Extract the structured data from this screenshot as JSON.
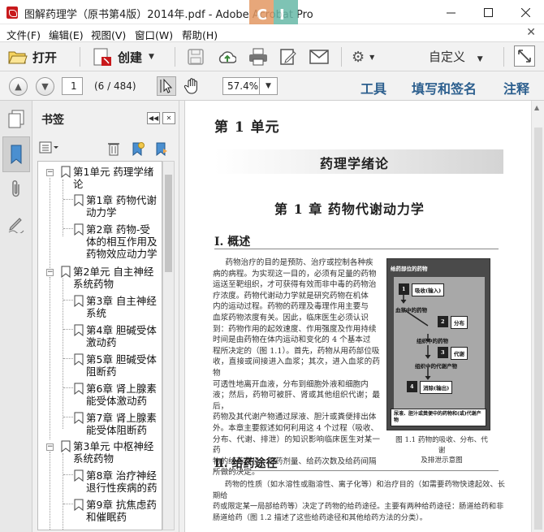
{
  "window": {
    "title": "图解药理学（原书第4版）2014年.pdf - Adobe Acrobat Pro",
    "controls": [
      "minimize",
      "maximize",
      "close"
    ]
  },
  "menu": {
    "items": [
      "文件(F)",
      "编辑(E)",
      "视图(V)",
      "窗口(W)",
      "帮助(H)"
    ]
  },
  "toolbar": {
    "open_label": "打开",
    "create_label": "创建",
    "custom_label": "自定义"
  },
  "nav": {
    "current_page": "1",
    "page_count": "(6 / 484)",
    "zoom": "57.4%",
    "tools_label": "工具",
    "fill_sign_label": "填写和签名",
    "comment_label": "注释"
  },
  "bookmarks": {
    "panel_title": "书签",
    "items": [
      {
        "line1": "第1单元  药理学绪",
        "line2": "论"
      },
      {
        "line1": "第1章  药物代谢",
        "line2": "动力学"
      },
      {
        "line1": "第2章  药物-受",
        "line2": "体的相互作用及",
        "line3": "药物效应动力学"
      },
      {
        "line1": "第2单元  自主神经",
        "line2": "系统药物"
      },
      {
        "line1": "第3章  自主神经",
        "line2": "系统"
      },
      {
        "line1": "第4章  胆碱受体",
        "line2": "激动药"
      },
      {
        "line1": "第5章  胆碱受体",
        "line2": "阻断药"
      },
      {
        "line1": "第6章  肾上腺素",
        "line2": "能受体激动药"
      },
      {
        "line1": "第7章  肾上腺素",
        "line2": "能受体阻断药"
      },
      {
        "line1": "第3单元  中枢神经",
        "line2": "系统药物"
      },
      {
        "line1": "第8章  治疗神经",
        "line2": "退行性疾病的药"
      },
      {
        "line1": "第9章  抗焦虑药",
        "line2": "和催眠药"
      }
    ]
  },
  "document": {
    "unit_title": "第 1 单元",
    "section_title": "药理学绪论",
    "chapter_title": "第 1 章    药物代谢动力学",
    "heading1": "Ⅰ. 概述",
    "para1": [
      "药物治疗的目的是预防、治疗或控制各种疾",
      "病的病程。为实现这一目的，必须有足量的药物",
      "运送至靶组织，才可获得有效而非中毒的药物治",
      "疗浓度。药物代谢动力学就是研究药物在机体",
      "内的运动过程。药物的药理及毒理作用主要与",
      "血浆药物浓度有关。因此，临床医生必须认识",
      "到：药物作用的起效速度、作用强度及作用持续",
      "时间是由药物在体内运动和变化的 4 个基本过",
      "程所决定的（图 1.1）。首先，药物从用药部位吸",
      "收，直接或间接进入血浆；其次，进入血浆的药物",
      "可透性地离开血液，分布到细胞外液和细胞内",
      "液；然后，药物可被肝、肾或其他组织代谢；最后，",
      "药物及其代谢产物通过尿液、胆汁或粪便排出体",
      "外。本章主要叙述如何利用这 4 个过程（吸收、",
      "分布、代谢、排泄）的知识影响临床医生对某一药",
      "物的给药途径、给药剂量、给药次数及给药间隔",
      "所做的决定。"
    ],
    "figure": {
      "header": "给药部位的药物",
      "steps": [
        "吸收(输入)",
        "分布",
        "代谢",
        "消除(输出)"
      ],
      "nodes": [
        "血浆中的药物",
        "组织中的药物",
        "组织中的代谢产物"
      ],
      "footer": "尿液、胆汁或粪便中的药物和(或)代谢产物",
      "markers": [
        "1",
        "2",
        "3",
        "4"
      ],
      "caption_line1": "图 1.1   药物的吸收、分布、代谢",
      "caption_line2": "及排泄示意图"
    },
    "heading2": "Ⅱ. 给药途径",
    "para2": [
      "药物的性质（如水溶性或脂溶性、离子化等）和治疗目的（如需要药物快速起效、长期给",
      "药或限定某一局部给药等）决定了药物的给药途径。主要有两种给药途径：肠道给药和非",
      "肠道给药（图 1.2 描述了这些给药途径和其他给药方法的分类）。"
    ]
  },
  "colors": {
    "accent_link": "#2c5f8e",
    "toolbar_bg": "#f2f2f2",
    "pdf_icon": "#c8191c"
  }
}
